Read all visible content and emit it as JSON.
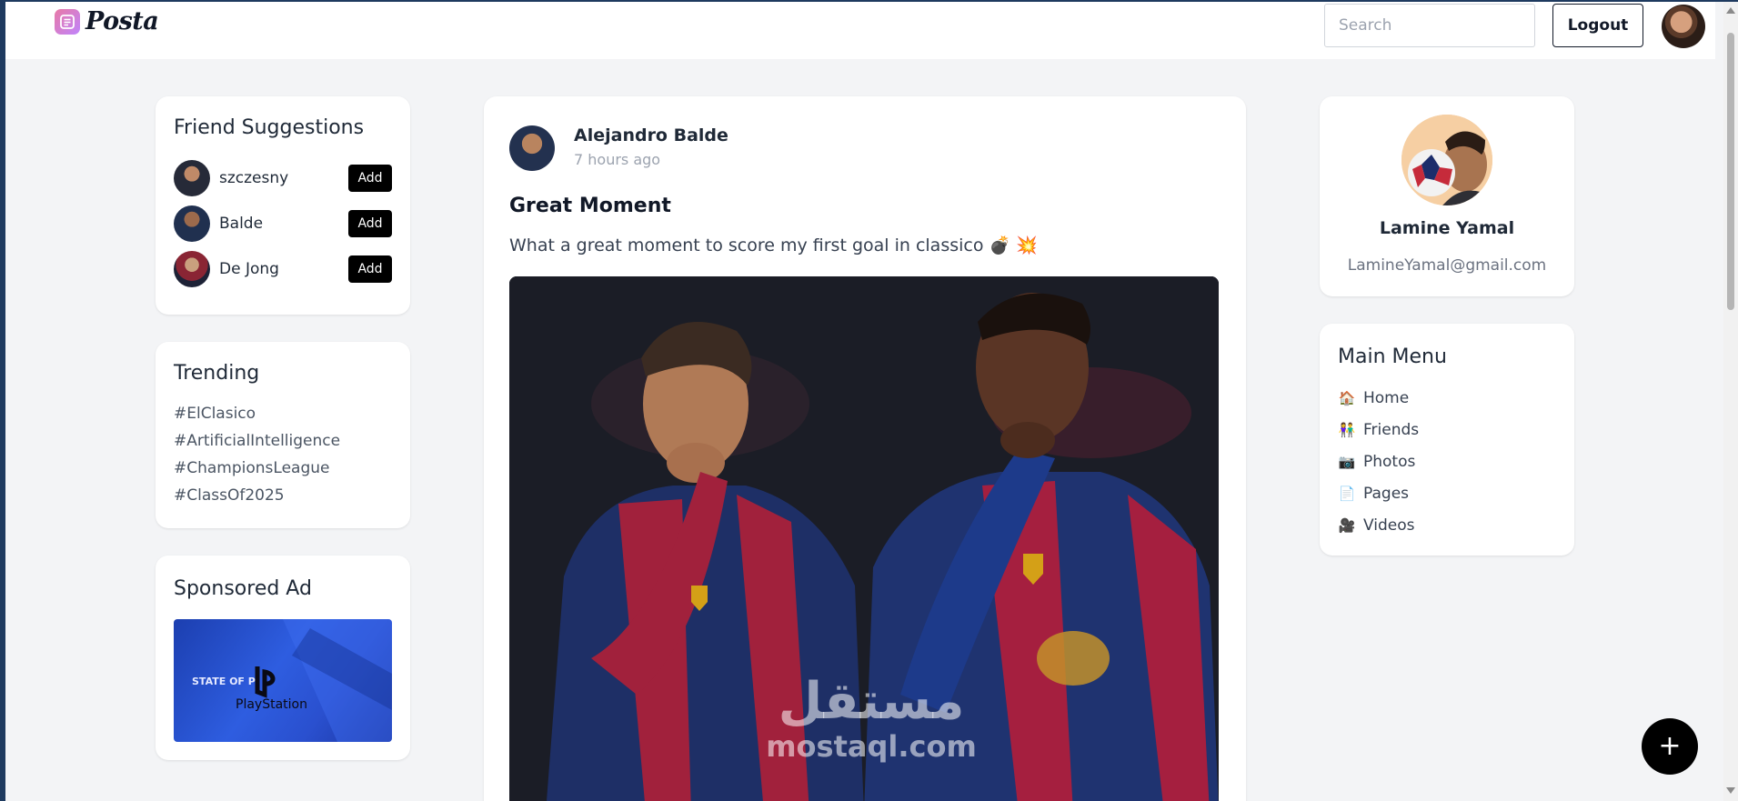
{
  "app": {
    "name": "Posta"
  },
  "header": {
    "search_placeholder": "Search",
    "logout_label": "Logout"
  },
  "friend_suggestions": {
    "title": "Friend Suggestions",
    "items": [
      {
        "name": "szczesny",
        "action": "Add"
      },
      {
        "name": "Balde",
        "action": "Add"
      },
      {
        "name": "De Jong",
        "action": "Add"
      }
    ]
  },
  "trending": {
    "title": "Trending",
    "tags": [
      "#ElClasico",
      "#ArtificialIntelligence",
      "#ChampionsLeague",
      "#ClassOf2025"
    ]
  },
  "sponsored": {
    "title": "Sponsored Ad",
    "ad_line1": "STATE OF P",
    "ad_brand": "PlayStation"
  },
  "post": {
    "author": "Alejandro Balde",
    "time": "7 hours ago",
    "title": "Great Moment",
    "text": "What a great moment to score my first goal in classico 💣 💥"
  },
  "profile": {
    "name": "Lamine Yamal",
    "email": "LamineYamal@gmail.com"
  },
  "main_menu": {
    "title": "Main Menu",
    "items": [
      {
        "icon": "🏠",
        "label": "Home"
      },
      {
        "icon": "👫",
        "label": "Friends"
      },
      {
        "icon": "📷",
        "label": "Photos"
      },
      {
        "icon": "📄",
        "label": "Pages"
      },
      {
        "icon": "🎥",
        "label": "Videos"
      }
    ]
  },
  "fab": {
    "label": "+"
  },
  "watermark": {
    "arabic": "مستقل",
    "latin": "mostaql.com"
  },
  "colors": {
    "accent": "#000000",
    "background": "#f3f4f6",
    "card": "#ffffff",
    "logo": "#e879a6"
  }
}
